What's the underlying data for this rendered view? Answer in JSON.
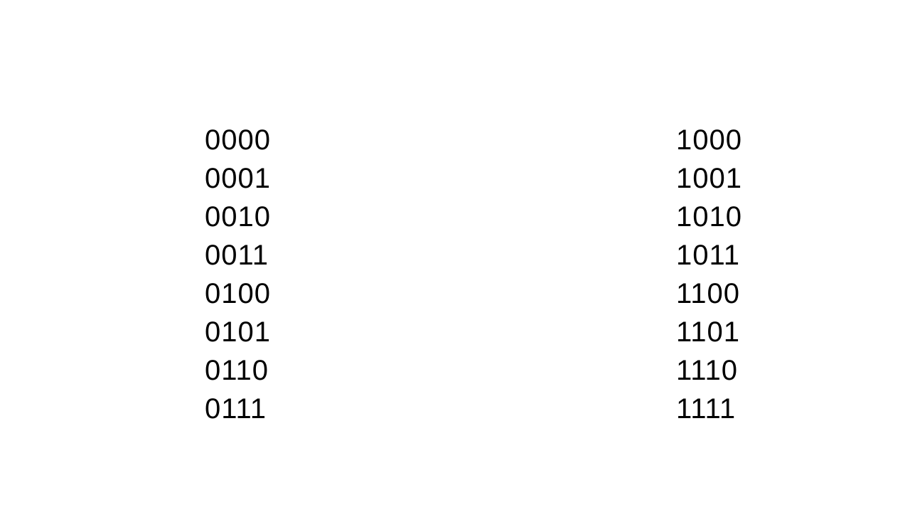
{
  "columns": {
    "left": [
      "0000",
      "0001",
      "0010",
      "0011",
      "0100",
      "0101",
      "0110",
      "0111"
    ],
    "right": [
      "1000",
      "1001",
      "1010",
      "1011",
      "1100",
      "1101",
      "1110",
      "1111"
    ]
  }
}
